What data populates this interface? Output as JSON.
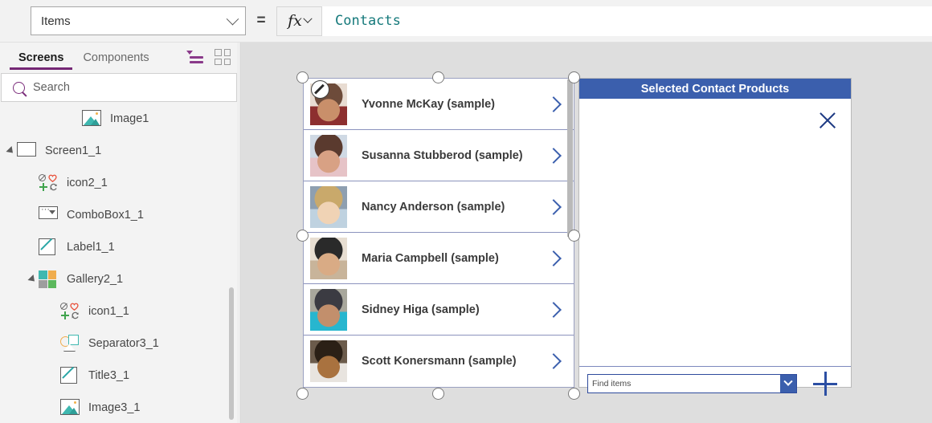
{
  "formula_bar": {
    "property": "Items",
    "equals": "=",
    "fx_label": "fx",
    "formula": "Contacts"
  },
  "sidebar": {
    "tabs": [
      {
        "label": "Screens",
        "active": true
      },
      {
        "label": "Components",
        "active": false
      }
    ],
    "view_icons": [
      {
        "name": "tree-view-icon"
      },
      {
        "name": "thumbnail-view-icon"
      }
    ],
    "search": {
      "placeholder": "Search"
    },
    "tree": [
      {
        "label": "Image1",
        "icon": "image-icon",
        "indent": 3,
        "caret": "none"
      },
      {
        "label": "Screen1_1",
        "icon": "screen-icon",
        "indent": 0,
        "caret": "expanded"
      },
      {
        "label": "icon2_1",
        "icon": "iconset-icon",
        "indent": 1,
        "caret": "none"
      },
      {
        "label": "ComboBox1_1",
        "icon": "combobox-icon",
        "indent": 1,
        "caret": "none"
      },
      {
        "label": "Label1_1",
        "icon": "label-icon",
        "indent": 1,
        "caret": "none"
      },
      {
        "label": "Gallery2_1",
        "icon": "gallery-icon",
        "indent": 1,
        "caret": "expanded"
      },
      {
        "label": "icon1_1",
        "icon": "iconset-icon",
        "indent": 2,
        "caret": "none"
      },
      {
        "label": "Separator3_1",
        "icon": "separator-icon",
        "indent": 2,
        "caret": "none"
      },
      {
        "label": "Title3_1",
        "icon": "label-icon",
        "indent": 2,
        "caret": "none"
      },
      {
        "label": "Image3_1",
        "icon": "image-icon",
        "indent": 2,
        "caret": "none"
      }
    ]
  },
  "canvas": {
    "gallery": {
      "rows": [
        {
          "name": "Yvonne McKay (sample)"
        },
        {
          "name": "Susanna Stubberod (sample)"
        },
        {
          "name": "Nancy Anderson (sample)"
        },
        {
          "name": "Maria Campbell (sample)"
        },
        {
          "name": "Sidney Higa (sample)"
        },
        {
          "name": "Scott Konersmann (sample)"
        }
      ]
    },
    "right_panel": {
      "title": "Selected Contact Products",
      "close_icon": "close-icon",
      "combobox": {
        "placeholder": "Find items"
      },
      "add_icon": "plus-icon"
    }
  },
  "colors": {
    "accent_purple": "#742774",
    "panel_blue": "#3b5fad",
    "formula_teal": "#15797b",
    "canvas_gray": "#dedede"
  }
}
